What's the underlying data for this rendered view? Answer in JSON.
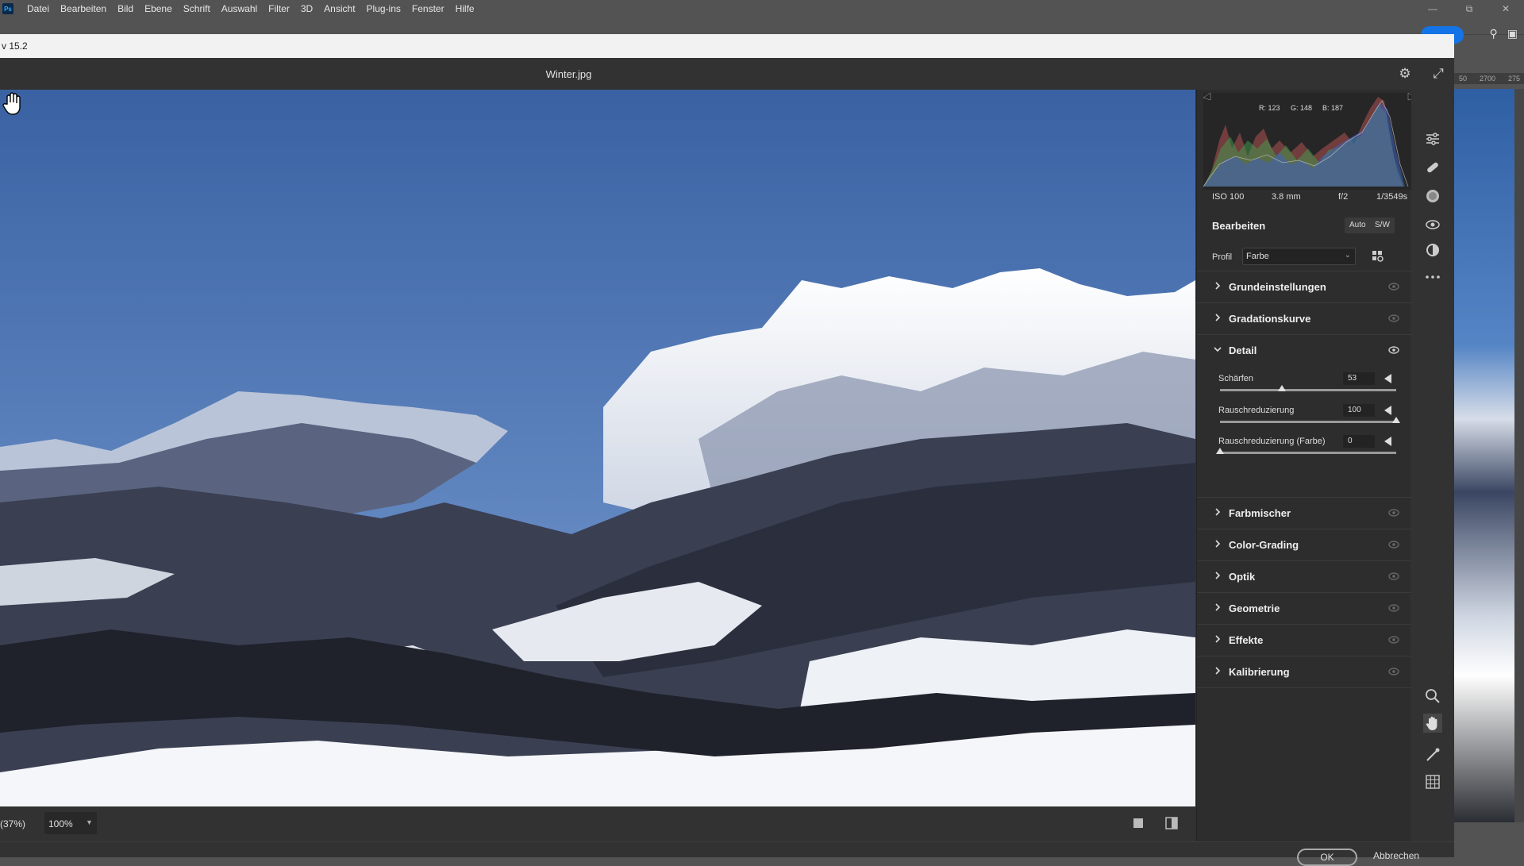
{
  "menubar": {
    "logo": "Ps",
    "items": [
      "Datei",
      "Bearbeiten",
      "Bild",
      "Ebene",
      "Schrift",
      "Auswahl",
      "Filter",
      "3D",
      "Ansicht",
      "Plug-ins",
      "Fenster",
      "Hilfe"
    ]
  },
  "ruler": {
    "ticks": [
      "50",
      "2700",
      "275"
    ]
  },
  "dialog": {
    "title": "v 15.2",
    "filename": "Winter.jpg"
  },
  "bottom": {
    "zoom_percent": "(37%)",
    "zoom_value": "100%"
  },
  "footer": {
    "ok": "OK",
    "cancel": "Abbrechen"
  },
  "histogram": {
    "rgb": {
      "r": "R: 123",
      "g": "G: 148",
      "b": "B: 187"
    },
    "exif": {
      "iso": "ISO 100",
      "focal": "3.8 mm",
      "aperture": "f/2",
      "shutter": "1/3549s"
    }
  },
  "edit": {
    "title": "Bearbeiten",
    "auto": "Auto",
    "bw": "S/W",
    "profile_label": "Profil",
    "profile_value": "Farbe"
  },
  "sections": {
    "grundeinstellungen": "Grundeinstellungen",
    "gradationskurve": "Gradationskurve",
    "detail": "Detail",
    "farbmischer": "Farbmischer",
    "color_grading": "Color-Grading",
    "optik": "Optik",
    "geometrie": "Geometrie",
    "effekte": "Effekte",
    "kalibrierung": "Kalibrierung"
  },
  "detail": {
    "sharpen": {
      "label": "Schärfen",
      "value": "53",
      "max": 150
    },
    "noise": {
      "label": "Rauschreduzierung",
      "value": "100",
      "max": 100
    },
    "color_noise": {
      "label": "Rauschreduzierung (Farbe)",
      "value": "0",
      "max": 100
    }
  },
  "colors": {
    "accent": "#1473e6",
    "panel": "#2d2d2d",
    "dialog": "#323232",
    "sky": "#3e66a6"
  },
  "icons": {
    "header": [
      "gear-icon",
      "expand-icon"
    ],
    "tools": [
      "sliders-icon",
      "healing-brush-icon",
      "mask-icon",
      "red-eye-icon",
      "presets-icon",
      "more-icon",
      "zoom-icon",
      "hand-icon",
      "color-sampler-icon",
      "grid-icon"
    ]
  }
}
